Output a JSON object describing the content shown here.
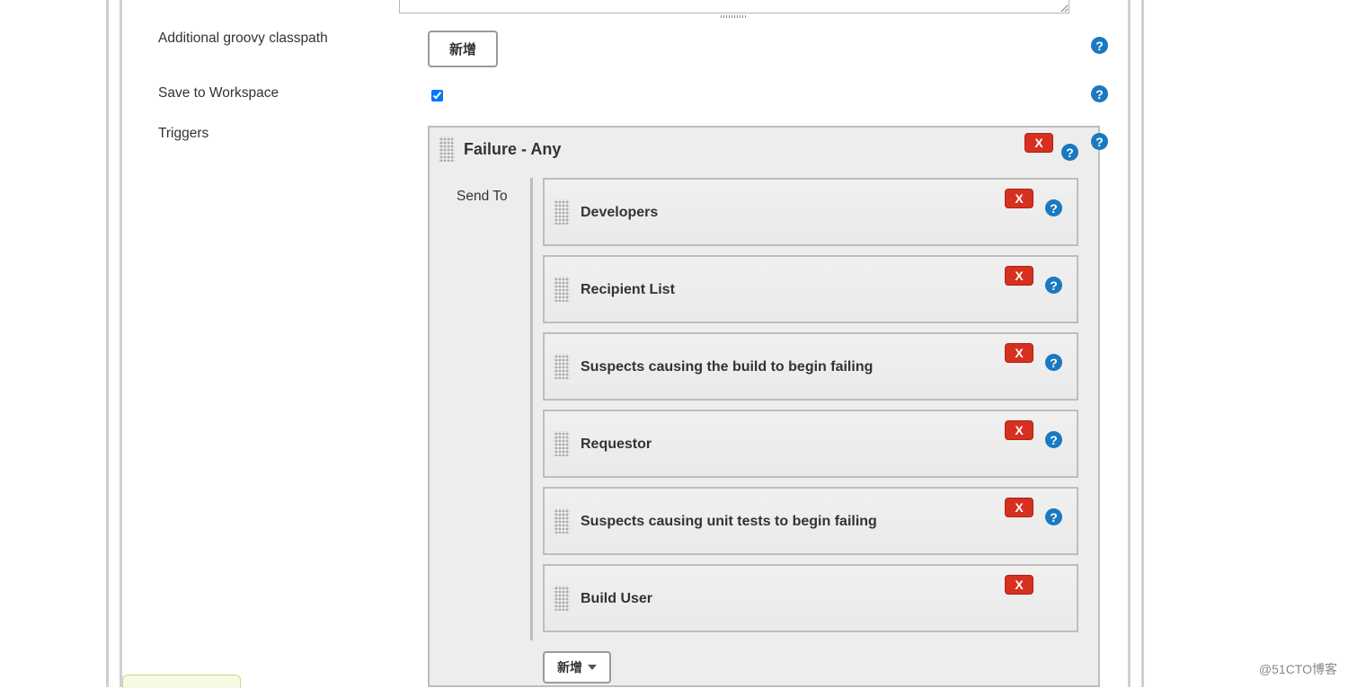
{
  "labels": {
    "additional_classpath": "Additional groovy classpath",
    "save_to_workspace": "Save to Workspace",
    "triggers": "Triggers",
    "send_to": "Send To"
  },
  "buttons": {
    "add": "新增",
    "add_dropdown": "新增"
  },
  "fields": {
    "save_to_workspace_checked": true
  },
  "trigger": {
    "title": "Failure - Any",
    "recipients": [
      {
        "label": "Developers",
        "has_help": true
      },
      {
        "label": "Recipient List",
        "has_help": true
      },
      {
        "label": "Suspects causing the build to begin failing",
        "has_help": true
      },
      {
        "label": "Requestor",
        "has_help": true
      },
      {
        "label": "Suspects causing unit tests to begin failing",
        "has_help": true
      },
      {
        "label": "Build User",
        "has_help": false
      }
    ]
  },
  "watermark": "@51CTO博客"
}
